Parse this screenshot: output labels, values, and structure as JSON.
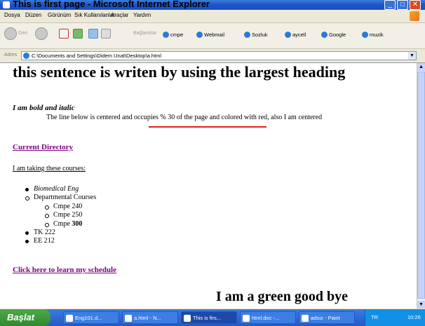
{
  "window": {
    "title": "This is first page - Microsoft Internet Explorer"
  },
  "menu": [
    "Dosya",
    "Düzen",
    "Görünüm",
    "Sık Kullanılanlar",
    "Araçlar",
    "Yardım"
  ],
  "toolbar": {
    "back": "Geri",
    "links_label": "Bağlantılar",
    "links": [
      "cmpe",
      "Webmail",
      "Sozluk",
      "aycell",
      "Google",
      "muzik"
    ]
  },
  "address": {
    "label": "Adres",
    "value": "C:\\Documents and Settings\\Didem Unat\\Desktop\\a.html"
  },
  "page": {
    "heading": "this sentence is writen by using the largest heading",
    "bold_italic": "I am bold and italic",
    "center_line": "The line below is centered and occupies % 30 of the page and colored with red, also I am centered",
    "link_dir": "Current Directory",
    "courses_text": "I am taking these courses:",
    "list": [
      {
        "text": "Biomedical Eng",
        "style": "italic",
        "level": 1,
        "bullet": "disc"
      },
      {
        "text": "Departmental Courses",
        "style": "normal",
        "level": 1,
        "bullet": "circle"
      },
      {
        "text": "Cmpe 240",
        "style": "normal",
        "level": 2,
        "bullet": "circle"
      },
      {
        "text": "Cmpe 250",
        "style": "normal",
        "level": 2,
        "bullet": "circle"
      },
      {
        "text": "Cmpe ",
        "bold_suffix": "300",
        "style": "normal",
        "level": 2,
        "bullet": "circle"
      },
      {
        "text": "TK 222",
        "style": "normal",
        "level": 1,
        "bullet": "disc"
      },
      {
        "text": "EE 212",
        "style": "normal",
        "level": 1,
        "bullet": "disc"
      }
    ],
    "link_schedule": "Click here to learn my schedule",
    "goodbye": "I am a green good bye"
  },
  "taskbar": {
    "start": "Başlat",
    "tasks": [
      "Eng101.d...",
      "a.html - N...",
      "This is firs...",
      "html.doc -...",
      "adsız - Paint"
    ],
    "tray_lang": "TR",
    "clock": "10:26"
  },
  "colors": {
    "link": "#800080",
    "rule": "#e02020",
    "titlebar": "#1b54c7"
  }
}
